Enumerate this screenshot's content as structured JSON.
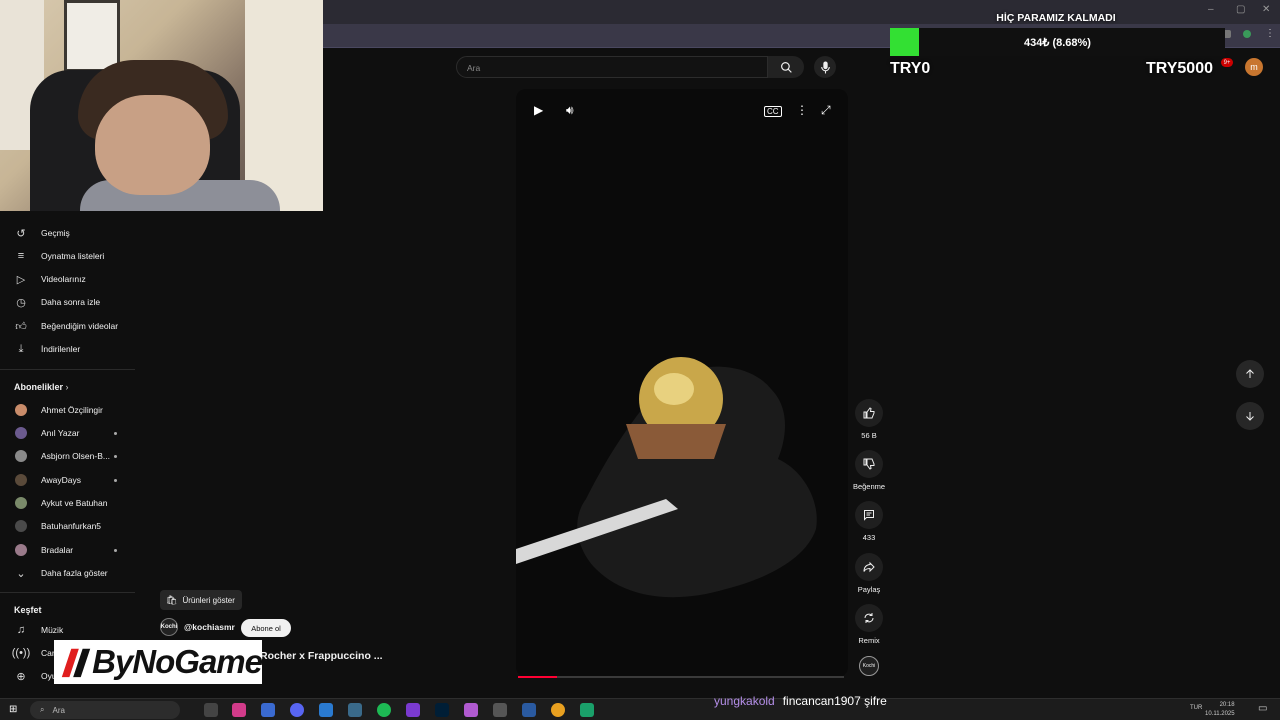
{
  "window": {
    "minimize": "–",
    "maximize": "▢",
    "close": "✕"
  },
  "search": {
    "placeholder": "Ara"
  },
  "sidebar": {
    "items": [
      {
        "label": "Geçmiş",
        "icon": "history-icon"
      },
      {
        "label": "Oynatma listeleri",
        "icon": "playlist-icon"
      },
      {
        "label": "Videolarınız",
        "icon": "your-videos-icon"
      },
      {
        "label": "Daha sonra izle",
        "icon": "watch-later-icon"
      },
      {
        "label": "Beğendiğim videolar",
        "icon": "liked-icon"
      },
      {
        "label": "İndirilenler",
        "icon": "download-icon"
      }
    ],
    "subscriptions_title": "Abonelikler",
    "subscriptions": [
      {
        "label": "Ahmet Özçilingir",
        "color": "#c98c6a",
        "dot": false
      },
      {
        "label": "Anıl Yazar",
        "color": "#6b5a8e",
        "dot": true
      },
      {
        "label": "Asbjorn Olsen-B...",
        "color": "#8a8a8a",
        "dot": true
      },
      {
        "label": "AwayDays",
        "color": "#5a4a3a",
        "dot": true
      },
      {
        "label": "Aykut ve Batuhan",
        "color": "#7a8a6a",
        "dot": false
      },
      {
        "label": "Batuhanfurkan5",
        "color": "#4a4a4a",
        "dot": false
      },
      {
        "label": "Bradalar",
        "color": "#9a7a8a",
        "dot": true
      }
    ],
    "show_more": "Daha fazla göster",
    "explore_title": "Keşfet",
    "explore": [
      {
        "label": "Müzik",
        "icon": "music-icon"
      },
      {
        "label": "Can",
        "icon": "live-icon"
      },
      {
        "label": "Oyu",
        "icon": "gaming-icon"
      }
    ]
  },
  "video": {
    "actions": [
      {
        "name": "like",
        "label": "56 B"
      },
      {
        "name": "dislike",
        "label": "Beğenme"
      },
      {
        "name": "comments",
        "label": "433"
      },
      {
        "name": "share",
        "label": "Paylaş"
      },
      {
        "name": "remix",
        "label": "Remix"
      }
    ],
    "products_label": "Ürünleri göster",
    "channel": "@kochiasmr",
    "channel_avatar_text": "Kochi",
    "subscribe_label": "Abone ol",
    "title": "Rocher x Frappuccino ...",
    "progress": 0.12
  },
  "overlay": {
    "goal_title": "HİÇ PARAMIZ KALMADI",
    "goal_percent_text": "434₺ (8.68%)",
    "goal_fraction": 0.0868,
    "goal_min": "TRY0",
    "goal_max": "TRY5000",
    "logo_text": "ByNoGame"
  },
  "header": {
    "avatar_letter": "m",
    "notif_count": "9+"
  },
  "chat": {
    "user": "yungkakold",
    "message": "fincancan1907 şifre"
  },
  "taskbar": {
    "search_placeholder": "Ara",
    "lang": "TUR",
    "time": "20:18",
    "date": "10.11.2025"
  }
}
